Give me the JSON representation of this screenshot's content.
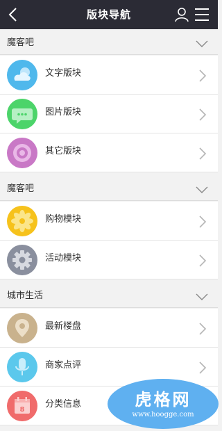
{
  "header": {
    "title": "版块导航"
  },
  "sections": [
    {
      "label": "魔客吧",
      "items": [
        {
          "label": "文字版块",
          "icon": "cloud-icon",
          "color": "#4fb8ec"
        },
        {
          "label": "图片版块",
          "icon": "chat-bubble-icon",
          "color": "#4cd46a"
        },
        {
          "label": "其它版块",
          "icon": "ring-icon",
          "color": "#c978c6"
        }
      ]
    },
    {
      "label": "魔客吧",
      "items": [
        {
          "label": "购物模块",
          "icon": "flower-icon",
          "color": "#f6c21c"
        },
        {
          "label": "活动模块",
          "icon": "gear-icon",
          "color": "#8a8f9e"
        }
      ]
    },
    {
      "label": "城市生活",
      "items": [
        {
          "label": "最新楼盘",
          "icon": "location-pin-icon",
          "color": "#c9b28d"
        },
        {
          "label": "商家点评",
          "icon": "microphone-icon",
          "color": "#5bc8ec"
        },
        {
          "label": "分类信息",
          "icon": "calendar-icon",
          "color": "#f06b6b"
        }
      ]
    }
  ],
  "watermark": {
    "main": "虎格网",
    "sub": "www.hoogge.com"
  }
}
